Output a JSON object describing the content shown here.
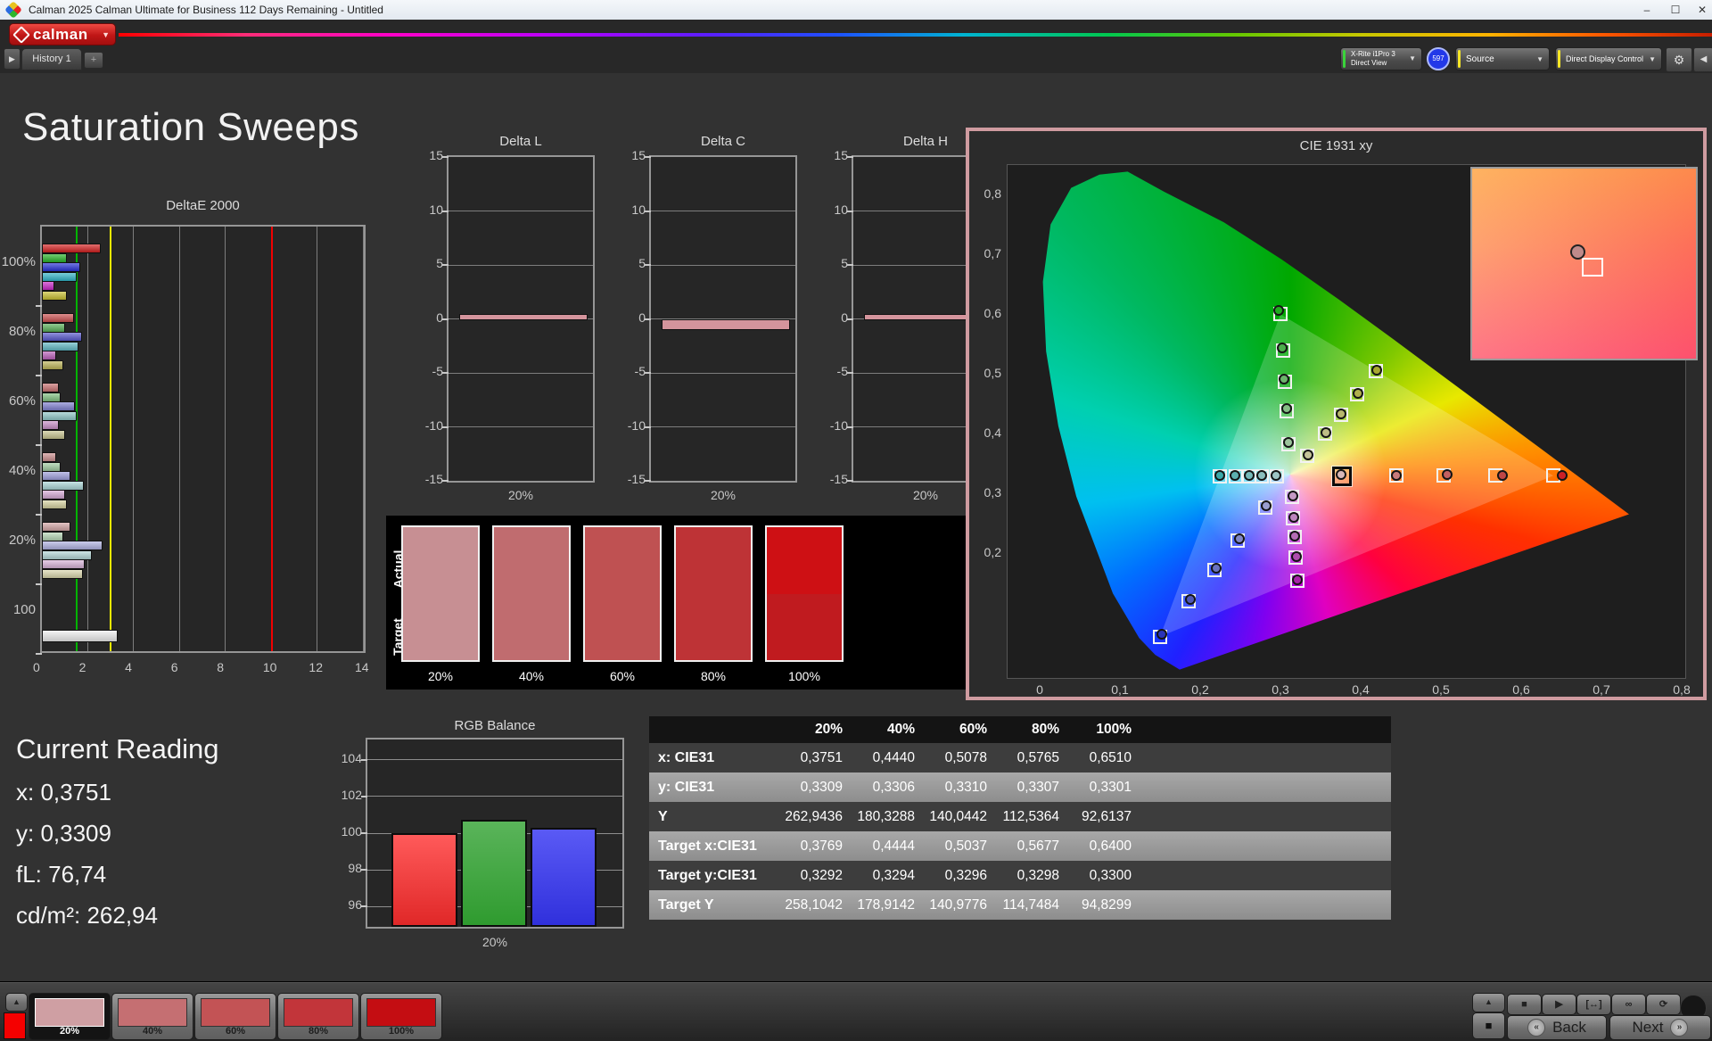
{
  "window": {
    "title": "Calman 2025 Calman Ultimate for Business 112 Days Remaining  - Untitled",
    "minimize": "–",
    "maximize": "☐",
    "close": "✕"
  },
  "header": {
    "logo_text": "calman"
  },
  "tabs": {
    "history_label": "History 1",
    "add_label": "+",
    "nav_arrow": "▶"
  },
  "toolbar": {
    "meter_line1": "X-Rite i1Pro 3",
    "meter_line2": "Direct View",
    "meter_badge": "597",
    "source_label": "Source",
    "display_control_label": "Direct Display Control",
    "gear": "⚙",
    "collapse": "◀"
  },
  "page": {
    "title": "Saturation Sweeps"
  },
  "current_reading": {
    "title": "Current Reading",
    "x": "x: 0,3751",
    "y": "y: 0,3309",
    "fl": "fL: 76,74",
    "cdm2": "cd/m²: 262,94"
  },
  "swatch_strip": {
    "actual_label": "Actual",
    "target_label": "Target",
    "labels": [
      "20%",
      "40%",
      "60%",
      "80%",
      "100%"
    ],
    "actual_colors": [
      "#c78f93",
      "#c06c6f",
      "#bf5152",
      "#be3336",
      "#ce1014"
    ],
    "target_colors": [
      "#c78f93",
      "#c06c6f",
      "#bf5152",
      "#be3336",
      "#c01b1f"
    ]
  },
  "bottom_bar": {
    "patch_arrow": "▲",
    "patch_color": "#f50000",
    "swatches": [
      {
        "label": "20%",
        "color": "#cf9fa3",
        "selected": true
      },
      {
        "label": "40%",
        "color": "#c56f72",
        "selected": false
      },
      {
        "label": "60%",
        "color": "#c35355",
        "selected": false
      },
      {
        "label": "80%",
        "color": "#c2353a",
        "selected": false
      },
      {
        "label": "100%",
        "color": "#c40d12",
        "selected": false
      }
    ],
    "transport": {
      "arrow": "▲",
      "stop_big": "■",
      "icons": [
        "■",
        "▶",
        "[↔]",
        "∞",
        "⟳"
      ]
    },
    "back_label": "Back",
    "next_label": "Next",
    "back_chev": "«",
    "next_chev": "»"
  },
  "chart_data": [
    {
      "id": "deltae2000",
      "type": "bar",
      "orientation": "horizontal",
      "title": "DeltaE 2000",
      "xlim": [
        0,
        14
      ],
      "xticks": [
        0,
        2,
        4,
        6,
        8,
        10,
        12,
        14
      ],
      "reference_lines": [
        {
          "value": 1.5,
          "color": "#00b400"
        },
        {
          "value": 3,
          "color": "#f0f000"
        },
        {
          "value": 10,
          "color": "#f00000"
        }
      ],
      "series_names": [
        "Red",
        "Green",
        "Blue",
        "Cyan",
        "Magenta",
        "Yellow"
      ],
      "groups": [
        {
          "label": "100%",
          "values": [
            2.5,
            1.0,
            1.6,
            1.45,
            0.45,
            1.0
          ],
          "colors": [
            "#d42020",
            "#28b428",
            "#2830d4",
            "#30b4c8",
            "#c828c8",
            "#c8c030"
          ]
        },
        {
          "label": "80%",
          "values": [
            1.3,
            0.95,
            1.65,
            1.5,
            0.55,
            0.85
          ],
          "colors": [
            "#cc5050",
            "#58b058",
            "#5858cc",
            "#60b8c4",
            "#bc60bc",
            "#bcb458"
          ]
        },
        {
          "label": "60%",
          "values": [
            0.65,
            0.75,
            1.35,
            1.45,
            0.65,
            0.95
          ],
          "colors": [
            "#c87070",
            "#80c080",
            "#8080d0",
            "#90c8c8",
            "#c890c8",
            "#c8c490"
          ]
        },
        {
          "label": "40%",
          "values": [
            0.55,
            0.75,
            1.15,
            1.75,
            0.95,
            1.0
          ],
          "colors": [
            "#cc8f8f",
            "#a0cca0",
            "#9f9fdd",
            "#aad6d6",
            "#d6aad6",
            "#d6d2a0"
          ]
        },
        {
          "label": "20%",
          "values": [
            1.15,
            0.85,
            2.55,
            2.1,
            1.8,
            1.7
          ],
          "colors": [
            "#d4a5a5",
            "#b5d6b5",
            "#b0b2e2",
            "#b5d8d8",
            "#dab5da",
            "#dcd8ae"
          ]
        },
        {
          "label": "100",
          "values": [
            3.2
          ],
          "colors": [
            "#efefef"
          ]
        }
      ]
    },
    {
      "id": "deltaL",
      "type": "bar",
      "title": "Delta L",
      "ylim": [
        -15,
        15
      ],
      "yticks": [
        15,
        10,
        5,
        0,
        -5,
        -10,
        -15
      ],
      "categories": [
        "20%"
      ],
      "values": [
        0.45
      ],
      "bar_color": "#d4949c"
    },
    {
      "id": "deltaC",
      "type": "bar",
      "title": "Delta C",
      "ylim": [
        -15,
        15
      ],
      "yticks": [
        15,
        10,
        5,
        0,
        -5,
        -10,
        -15
      ],
      "categories": [
        "20%"
      ],
      "values": [
        -0.9
      ],
      "bar_color": "#d4949c"
    },
    {
      "id": "deltaH",
      "type": "bar",
      "title": "Delta H",
      "ylim": [
        -15,
        15
      ],
      "yticks": [
        15,
        10,
        5,
        0,
        -5,
        -10,
        -15
      ],
      "categories": [
        "20%"
      ],
      "values": [
        0.45
      ],
      "bar_color": "#d4949c"
    },
    {
      "id": "cie1931",
      "type": "scatter",
      "title": "CIE 1931 xy",
      "xlim": [
        0,
        0.8
      ],
      "ylim": [
        0,
        0.85
      ],
      "xtick_values": [
        0,
        0.1,
        0.2,
        0.3,
        0.4,
        0.5,
        0.6,
        0.7,
        0.8
      ],
      "xtick_labels": [
        "0",
        "0,1",
        "0,2",
        "0,3",
        "0,4",
        "0,5",
        "0,6",
        "0,7",
        "0,8"
      ],
      "ytick_values": [
        0.8,
        0.7,
        0.6,
        0.5,
        0.4,
        0.3,
        0.2
      ],
      "ytick_labels": [
        "0,8",
        "0,7",
        "0,6",
        "0,5",
        "0,4",
        "0,3",
        "0,2"
      ],
      "white_point": [
        0.3127,
        0.329
      ],
      "gamut_triangle": [
        [
          0.64,
          0.33
        ],
        [
          0.3,
          0.6
        ],
        [
          0.15,
          0.06
        ]
      ],
      "sweeps": [
        {
          "name": "red",
          "current_index": 0,
          "point_colors": [
            "#d8b8b8",
            "#c87b7b",
            "#c36060",
            "#bf4646",
            "#cc2026"
          ],
          "targets": [
            [
              0.3769,
              0.3292
            ],
            [
              0.4444,
              0.3294
            ],
            [
              0.5037,
              0.3296
            ],
            [
              0.5677,
              0.3298
            ],
            [
              0.64,
              0.33
            ]
          ],
          "actuals": [
            [
              0.3751,
              0.3309
            ],
            [
              0.444,
              0.3306
            ],
            [
              0.5078,
              0.331
            ],
            [
              0.5765,
              0.3307
            ],
            [
              0.651,
              0.3301
            ]
          ]
        },
        {
          "name": "green",
          "current_index": -1,
          "point_colors": [
            "#9cc49c",
            "#85bd85",
            "#6cb56c",
            "#4cae4c",
            "#1fae1f"
          ],
          "targets": [
            [
              0.31,
              0.382
            ],
            [
              0.308,
              0.438
            ],
            [
              0.305,
              0.487
            ],
            [
              0.303,
              0.54
            ],
            [
              0.3,
              0.6
            ]
          ],
          "actuals": [
            [
              0.3095,
              0.3855
            ],
            [
              0.3075,
              0.4425
            ],
            [
              0.3045,
              0.491
            ],
            [
              0.302,
              0.5445
            ],
            [
              0.298,
              0.606
            ]
          ]
        },
        {
          "name": "blue",
          "current_index": -1,
          "point_colors": [
            "#9a9ecf",
            "#8288c8",
            "#6a72c0",
            "#5058b8",
            "#2b34b8"
          ],
          "targets": [
            [
              0.281,
              0.276
            ],
            [
              0.247,
              0.221
            ],
            [
              0.218,
              0.172
            ],
            [
              0.186,
              0.119
            ],
            [
              0.15,
              0.06
            ]
          ],
          "actuals": [
            [
              0.282,
              0.279
            ],
            [
              0.2485,
              0.2235
            ],
            [
              0.2195,
              0.175
            ],
            [
              0.1875,
              0.122
            ],
            [
              0.152,
              0.0635
            ]
          ]
        },
        {
          "name": "cyan",
          "current_index": -1,
          "point_colors": [
            "#9ec4c4",
            "#8abebe",
            "#74b8b8",
            "#5cb0b0",
            "#3aa8a8"
          ],
          "targets": [
            [
              0.2954,
              0.3289
            ],
            [
              0.2772,
              0.3289
            ],
            [
              0.2613,
              0.3288
            ],
            [
              0.244,
              0.3288
            ],
            [
              0.2246,
              0.3287
            ]
          ],
          "actuals": [
            [
              0.2948,
              0.33
            ],
            [
              0.2766,
              0.3302
            ],
            [
              0.2606,
              0.33
            ],
            [
              0.2433,
              0.3299
            ],
            [
              0.224,
              0.3296
            ]
          ]
        },
        {
          "name": "magenta",
          "current_index": -1,
          "point_colors": [
            "#c49ac4",
            "#bd85bd",
            "#b56cb5",
            "#ae4cae",
            "#a824a8"
          ],
          "targets": [
            [
              0.3143,
              0.2947
            ],
            [
              0.316,
              0.2585
            ],
            [
              0.3175,
              0.2269
            ],
            [
              0.3191,
              0.1927
            ],
            [
              0.3209,
              0.1542
            ]
          ],
          "actuals": [
            [
              0.315,
              0.296
            ],
            [
              0.3168,
              0.26
            ],
            [
              0.3183,
              0.2285
            ],
            [
              0.3198,
              0.1945
            ],
            [
              0.3215,
              0.156
            ]
          ]
        },
        {
          "name": "yellow",
          "current_index": -1,
          "point_colors": [
            "#c4c49a",
            "#bebe85",
            "#b8b86c",
            "#b0b04c",
            "#a8a830"
          ],
          "targets": [
            [
              0.3336,
              0.3636
            ],
            [
              0.3557,
              0.4
            ],
            [
              0.375,
              0.432
            ],
            [
              0.3958,
              0.4665
            ],
            [
              0.4193,
              0.5053
            ]
          ],
          "actuals": [
            [
              0.3342,
              0.365
            ],
            [
              0.3562,
              0.4015
            ],
            [
              0.3755,
              0.4335
            ],
            [
              0.3962,
              0.468
            ],
            [
              0.4198,
              0.5068
            ]
          ]
        }
      ],
      "inset_colors": {
        "tl": "#ffb37e",
        "tr": "#f9684c",
        "bl": "#fd86ae",
        "br": "#fb4a72"
      },
      "inset_dot_color": "#bf8a8a"
    },
    {
      "id": "rgb_balance",
      "type": "bar",
      "title": "RGB Balance",
      "ylim": [
        94.9,
        105.1
      ],
      "yticks": [
        104,
        102,
        100,
        98,
        96
      ],
      "categories": [
        "20%"
      ],
      "series": [
        {
          "name": "Red",
          "value": 100.0,
          "color_top": "#ff5a5a",
          "color_bottom": "#e02828"
        },
        {
          "name": "Green",
          "value": 100.75,
          "color_top": "#5ab45a",
          "color_bottom": "#2f9b2f"
        },
        {
          "name": "Blue",
          "value": 100.3,
          "color_top": "#5a5af5",
          "color_bottom": "#3030dc"
        }
      ]
    },
    {
      "id": "measurement_table",
      "type": "table",
      "columns": [
        "",
        "20%",
        "40%",
        "60%",
        "80%",
        "100%"
      ],
      "rows": [
        {
          "label": "x: CIE31",
          "values": [
            "0,3751",
            "0,4440",
            "0,5078",
            "0,5765",
            "0,6510"
          ]
        },
        {
          "label": "y: CIE31",
          "values": [
            "0,3309",
            "0,3306",
            "0,3310",
            "0,3307",
            "0,3301"
          ]
        },
        {
          "label": "Y",
          "values": [
            "262,9436",
            "180,3288",
            "140,0442",
            "112,5364",
            "92,6137"
          ]
        },
        {
          "label": "Target x:CIE31",
          "values": [
            "0,3769",
            "0,4444",
            "0,5037",
            "0,5677",
            "0,6400"
          ]
        },
        {
          "label": "Target y:CIE31",
          "values": [
            "0,3292",
            "0,3294",
            "0,3296",
            "0,3298",
            "0,3300"
          ]
        },
        {
          "label": "Target Y",
          "values": [
            "258,1042",
            "178,9142",
            "140,9776",
            "114,7484",
            "94,8299"
          ]
        }
      ]
    }
  ]
}
